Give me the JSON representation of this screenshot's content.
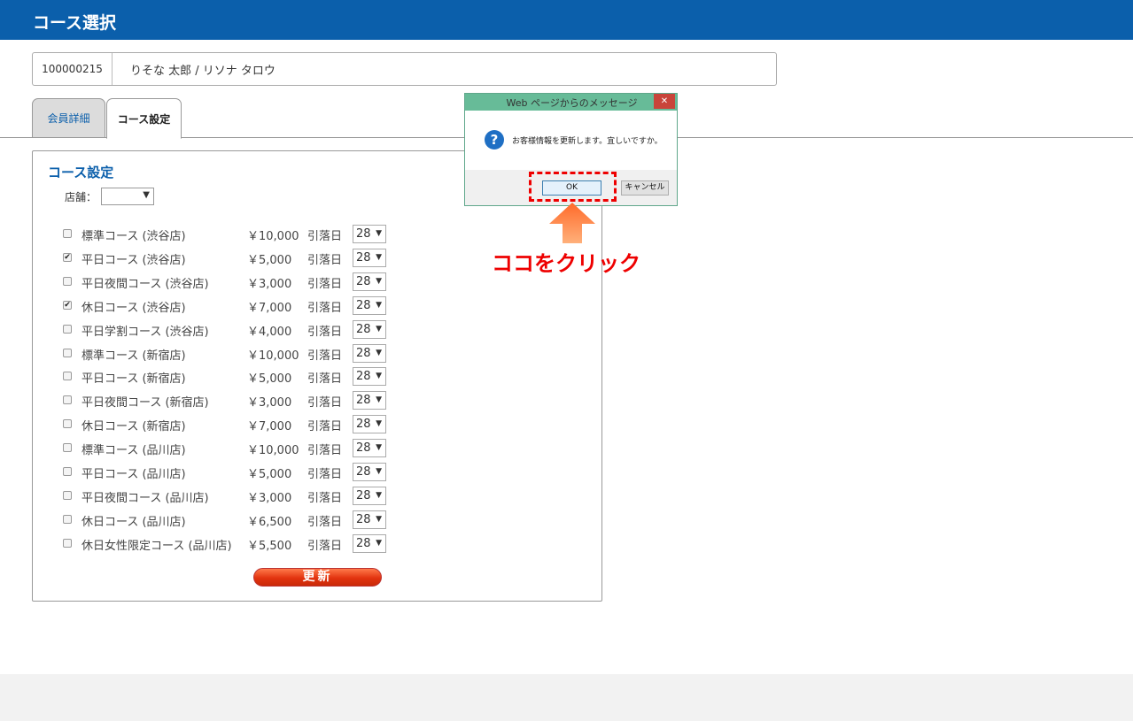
{
  "header": {
    "title": "コース選択"
  },
  "member": {
    "id": "100000215",
    "name": "りそな 太郎 / リソナ タロウ"
  },
  "tabs": [
    {
      "label": "会員詳細"
    },
    {
      "label": "コース設定"
    }
  ],
  "panel": {
    "title": "コース設定",
    "store_label": "店舗：",
    "store_value": "",
    "debit_label": "引落日",
    "update_label": "更新"
  },
  "courses": [
    {
      "name": "標準コース (渋谷店)",
      "price": "￥10,000",
      "checked": false,
      "day": "28"
    },
    {
      "name": "平日コース (渋谷店)",
      "price": "￥5,000",
      "checked": true,
      "day": "28"
    },
    {
      "name": "平日夜間コース (渋谷店)",
      "price": "￥3,000",
      "checked": false,
      "day": "28"
    },
    {
      "name": "休日コース (渋谷店)",
      "price": "￥7,000",
      "checked": true,
      "day": "28"
    },
    {
      "name": "平日学割コース (渋谷店)",
      "price": "￥4,000",
      "checked": false,
      "day": "28"
    },
    {
      "name": "標準コース (新宿店)",
      "price": "￥10,000",
      "checked": false,
      "day": "28"
    },
    {
      "name": "平日コース (新宿店)",
      "price": "￥5,000",
      "checked": false,
      "day": "28"
    },
    {
      "name": "平日夜間コース (新宿店)",
      "price": "￥3,000",
      "checked": false,
      "day": "28"
    },
    {
      "name": "休日コース (新宿店)",
      "price": "￥7,000",
      "checked": false,
      "day": "28"
    },
    {
      "name": "標準コース (品川店)",
      "price": "￥10,000",
      "checked": false,
      "day": "28"
    },
    {
      "name": "平日コース (品川店)",
      "price": "￥5,000",
      "checked": false,
      "day": "28"
    },
    {
      "name": "平日夜間コース (品川店)",
      "price": "￥3,000",
      "checked": false,
      "day": "28"
    },
    {
      "name": "休日コース (品川店)",
      "price": "￥6,500",
      "checked": false,
      "day": "28"
    },
    {
      "name": "休日女性限定コース (品川店)",
      "price": "￥5,500",
      "checked": false,
      "day": "28"
    }
  ],
  "dialog": {
    "title": "Web ページからのメッセージ",
    "message": "お客様情報を更新します。宜しいですか。",
    "ok_label": "OK",
    "cancel_label": "キャンセル",
    "close_glyph": "✕"
  },
  "annotation": {
    "text": "ココをクリック",
    "color": "#e00000"
  }
}
